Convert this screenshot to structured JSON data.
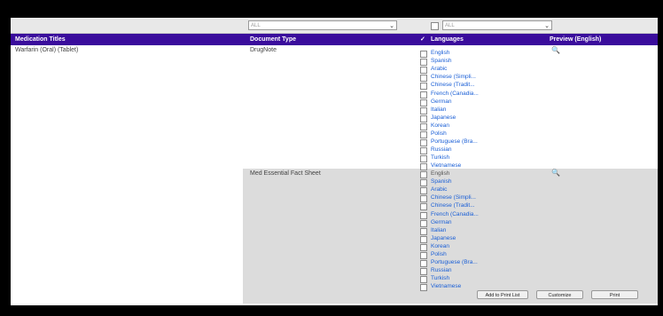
{
  "filters": {
    "doc_type_value": "ALL",
    "language_value": "ALL"
  },
  "header": {
    "col_medication": "Medication Titles",
    "col_doctype": "Document Type",
    "col_check": "✓",
    "col_languages": "Languages",
    "col_preview": "Preview (English)"
  },
  "medication": "Warfarin (Oral) (Tablet)",
  "documents": [
    {
      "type": "DrugNote",
      "languages": [
        "English",
        "Spanish",
        "Arabic",
        "Chinese (Simpli...",
        "Chinese (Tradit...",
        "French (Canadia...",
        "German",
        "Italian",
        "Japanese",
        "Korean",
        "Polish",
        "Portuguese (Bra...",
        "Russian",
        "Turkish",
        "Vietnamese"
      ]
    },
    {
      "type": "Med Essential Fact Sheet",
      "languages": [
        "English",
        "Spanish",
        "Arabic",
        "Chinese (Simpli...",
        "Chinese (Tradit...",
        "French (Canadia...",
        "German",
        "Italian",
        "Japanese",
        "Korean",
        "Polish",
        "Portuguese (Bra...",
        "Russian",
        "Turkish",
        "Vietnamese"
      ]
    }
  ],
  "buttons": {
    "add_to_print_list": "Add to Print List",
    "customize": "Customize",
    "print": "Print"
  },
  "icons": {
    "preview": "magnifier-icon",
    "dropdown": "chevron-down-icon"
  }
}
